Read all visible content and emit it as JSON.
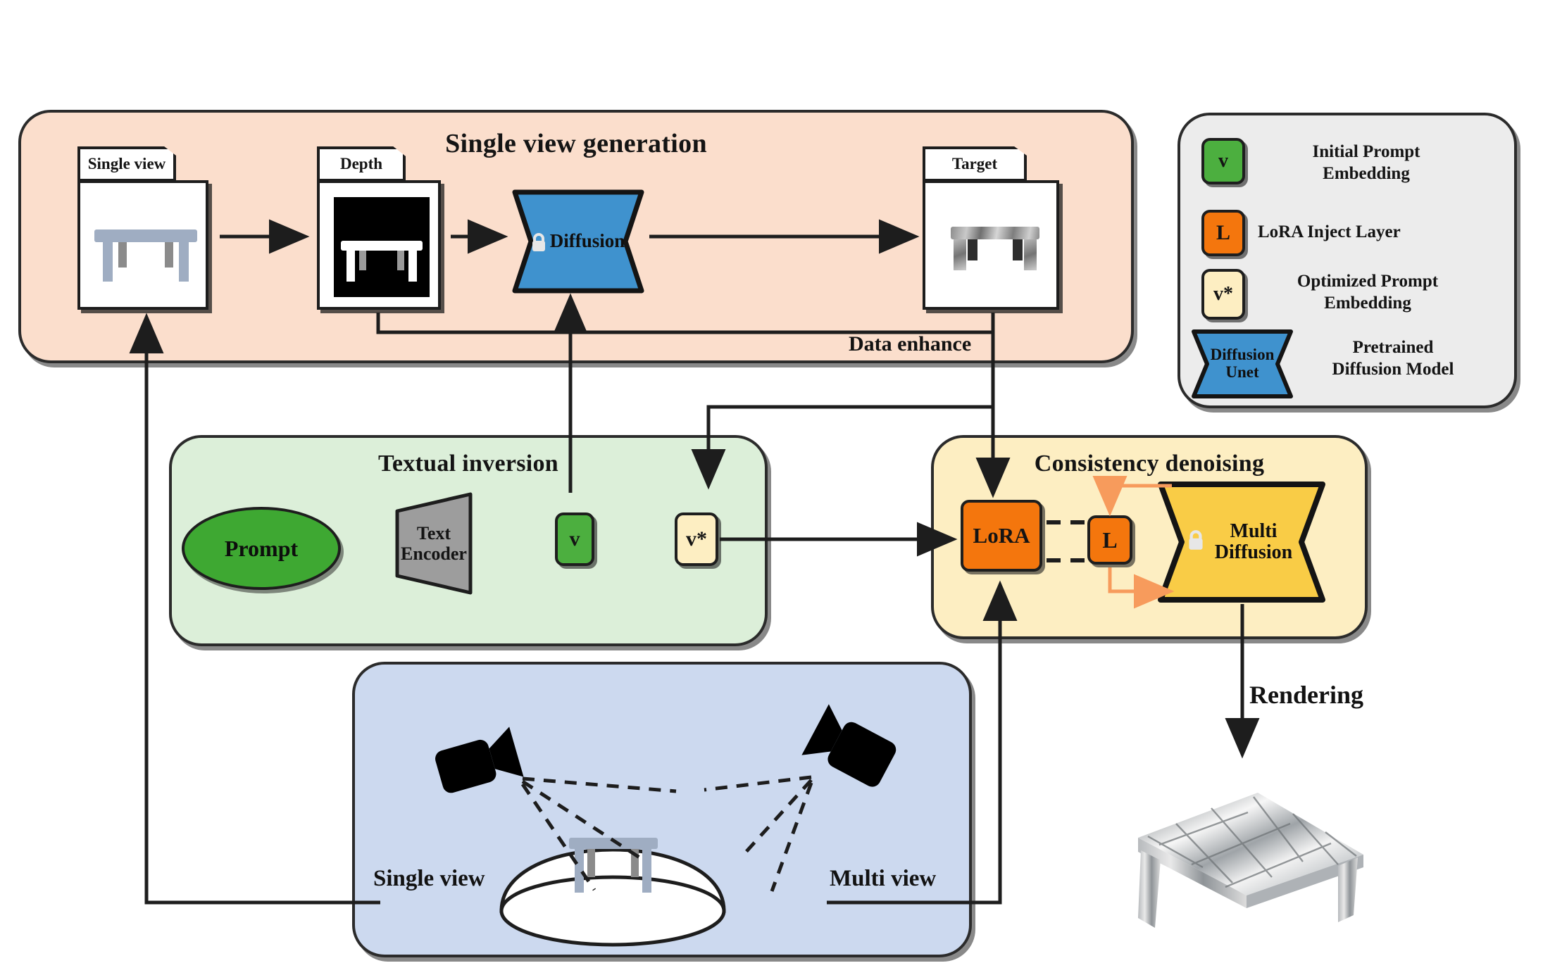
{
  "panels": {
    "single_view_generation": {
      "title": "Single view generation",
      "color": "#fbdecc",
      "cards": [
        {
          "label": "Single view",
          "name": "single-view-card"
        },
        {
          "label": "Depth",
          "name": "depth-card"
        },
        {
          "label": "Target",
          "name": "target-card"
        }
      ],
      "model": {
        "label": "Diffusion",
        "color": "#3f92ce",
        "locked": true
      },
      "edge_label": "Data enhance"
    },
    "textual_inversion": {
      "title": "Textual inversion",
      "color": "#dcefd9",
      "prompt": {
        "label": "Prompt",
        "color": "#3ea832"
      },
      "encoder": {
        "label_line1": "Text",
        "label_line2": "Encoder",
        "color": "#9d9d9d"
      },
      "initial_embedding": {
        "label": "v",
        "color": "#4caf3f"
      },
      "optimized_embedding": {
        "label": "v*",
        "color": "#fdeec2"
      }
    },
    "consistency_denoising": {
      "title": "Consistency denoising",
      "color": "#fdeec2",
      "lora": {
        "label": "LoRA",
        "color": "#f4760d"
      },
      "inject": {
        "label": "L",
        "color": "#f4760d"
      },
      "model": {
        "label_line1": "Multi",
        "label_line2": "Diffusion",
        "color": "#f9cc46",
        "locked": true
      }
    },
    "multi_view": {
      "color": "#ccd9ef",
      "left_label": "Single view",
      "right_label": "Multi  view",
      "cameras": 2
    }
  },
  "flow": {
    "rendering_label": "Rendering"
  },
  "legend": {
    "items": [
      {
        "glyph": "v",
        "color": "#4caf3f",
        "label": "Initial  Prompt\nEmbedding",
        "line1": "Initial  Prompt",
        "line2": "Embedding",
        "shape": "box"
      },
      {
        "glyph": "L",
        "color": "#f4760d",
        "label": "LoRA Inject Layer",
        "line1": "LoRA Inject Layer",
        "line2": "",
        "shape": "box"
      },
      {
        "glyph": "v*",
        "color": "#fdeec2",
        "label": "Optimized  Prompt\nEmbedding",
        "line1": "Optimized  Prompt",
        "line2": "Embedding",
        "shape": "box"
      },
      {
        "glyph": "Diffusion\nUnet",
        "color": "#3f92ce",
        "label": "Pretrained\nDiffusion Model",
        "line1": "Pretrained",
        "line2": "Diffusion Model",
        "shape": "bowtie",
        "glyph_line1": "Diffusion",
        "glyph_line2": "Unet"
      }
    ]
  },
  "colors": {
    "stroke": "#1d1d1d",
    "orange_accent": "#f79b5c",
    "panel_single": "#fbdecc",
    "panel_textual": "#dcefd9",
    "panel_consistency": "#fdeec2",
    "panel_multiview": "#ccd9ef",
    "panel_legend": "#ececec"
  }
}
